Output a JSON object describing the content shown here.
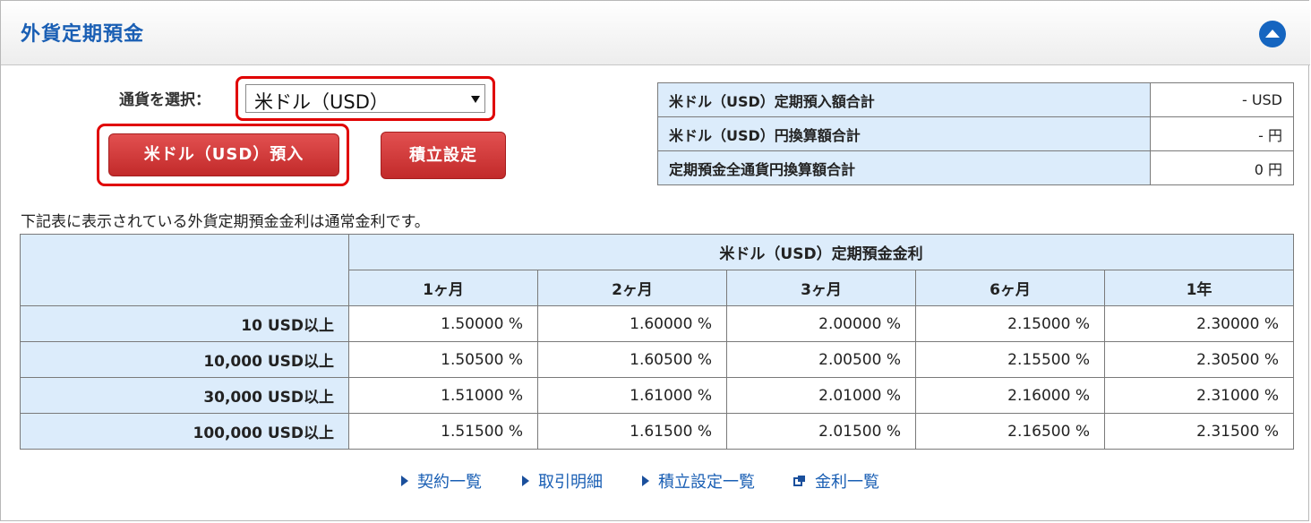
{
  "header": {
    "title": "外貨定期預金"
  },
  "currency_select": {
    "label": "通貨を選択：",
    "selected": "米ドル（USD）"
  },
  "buttons": {
    "deposit": "米ドル（USD）預入",
    "plan_settings": "積立設定"
  },
  "summary": [
    {
      "label": "米ドル（USD）定期預入額合計",
      "value": "- USD"
    },
    {
      "label": "米ドル（USD）円換算額合計",
      "value": "- 円"
    },
    {
      "label": "定期預金全通貨円換算額合計",
      "value": "0 円"
    }
  ],
  "note": "下記表に表示されている外貨定期預金金利は通常金利です。",
  "rates_table": {
    "title": "米ドル（USD）定期預金金利",
    "columns": [
      "1ヶ月",
      "2ヶ月",
      "3ヶ月",
      "6ヶ月",
      "1年"
    ],
    "rows": [
      {
        "tier": "10 USD以上",
        "values": [
          "1.50000 %",
          "1.60000 %",
          "2.00000 %",
          "2.15000 %",
          "2.30000 %"
        ]
      },
      {
        "tier": "10,000 USD以上",
        "values": [
          "1.50500 %",
          "1.60500 %",
          "2.00500 %",
          "2.15500 %",
          "2.30500 %"
        ]
      },
      {
        "tier": "30,000 USD以上",
        "values": [
          "1.51000 %",
          "1.61000 %",
          "2.01000 %",
          "2.16000 %",
          "2.31000 %"
        ]
      },
      {
        "tier": "100,000 USD以上",
        "values": [
          "1.51500 %",
          "1.61500 %",
          "2.01500 %",
          "2.16500 %",
          "2.31500 %"
        ]
      }
    ]
  },
  "links": [
    {
      "label": "契約一覧",
      "icon": "triangle-right-icon"
    },
    {
      "label": "取引明細",
      "icon": "triangle-right-icon"
    },
    {
      "label": "積立設定一覧",
      "icon": "triangle-right-icon"
    },
    {
      "label": "金利一覧",
      "icon": "new-window-icon"
    }
  ],
  "colors": {
    "accent_blue": "#1a5fb4",
    "button_red": "#c22a2a",
    "highlight_red": "#e00000",
    "header_cell": "#dcecfb"
  }
}
